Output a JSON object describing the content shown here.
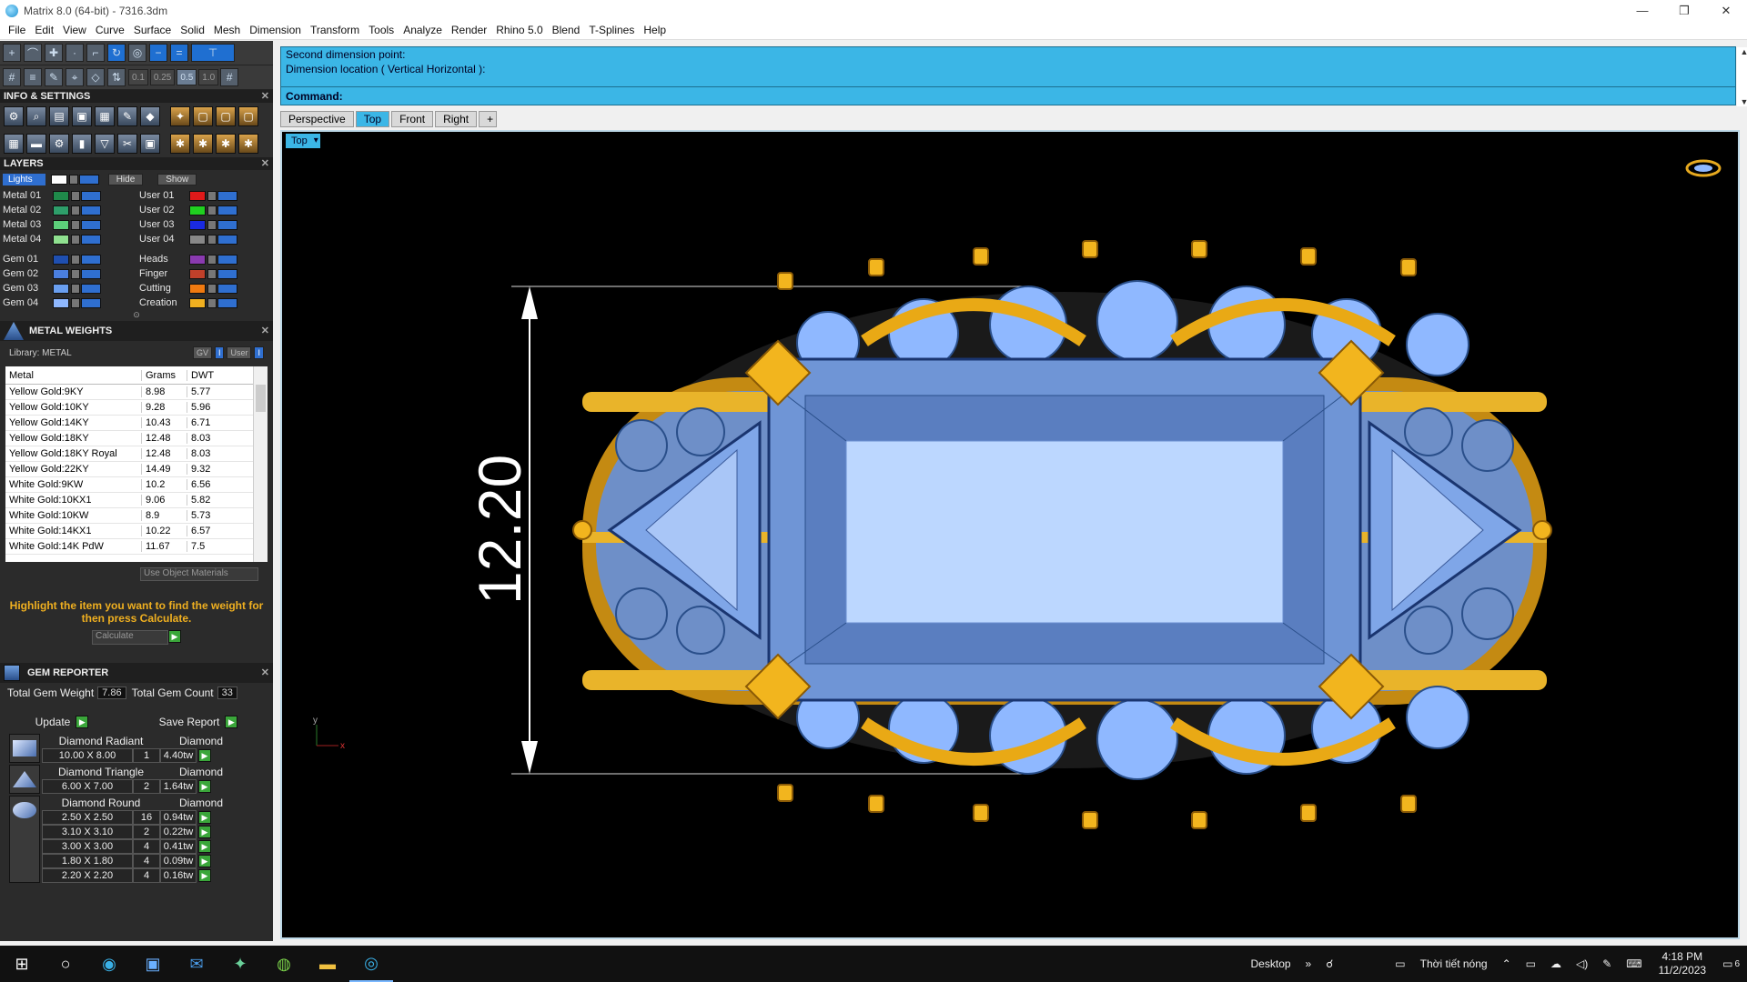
{
  "window": {
    "title": "Matrix 8.0 (64-bit) - 7316.3dm",
    "controls": [
      "—",
      "❐",
      "✕"
    ]
  },
  "menu": [
    "File",
    "Edit",
    "View",
    "Curve",
    "Surface",
    "Solid",
    "Mesh",
    "Dimension",
    "Transform",
    "Tools",
    "Analyze",
    "Render",
    "Rhino 5.0",
    "Blend",
    "T-Splines",
    "Help"
  ],
  "toolbar": {
    "snap_values": [
      "0.1",
      "0.25",
      "0.5",
      "1.0"
    ]
  },
  "info_settings": {
    "title": "INFO & SETTINGS"
  },
  "layers": {
    "title": "LAYERS",
    "lights_label": "Lights",
    "hide_label": "Hide",
    "show_label": "Show",
    "left": [
      {
        "name": "Metal 01",
        "color": "#1f8a4a"
      },
      {
        "name": "Metal 02",
        "color": "#2e9e6a"
      },
      {
        "name": "Metal 03",
        "color": "#5cd07a"
      },
      {
        "name": "Metal 04",
        "color": "#8fe08f"
      },
      {
        "name": "Gem 01",
        "color": "#1f4fb0"
      },
      {
        "name": "Gem 02",
        "color": "#4a7fe0"
      },
      {
        "name": "Gem 03",
        "color": "#6a9ff0"
      },
      {
        "name": "Gem 04",
        "color": "#8fb8ff"
      }
    ],
    "right": [
      {
        "name": "User 01",
        "color": "#e01a1a"
      },
      {
        "name": "User 02",
        "color": "#20d020"
      },
      {
        "name": "User 03",
        "color": "#1a2ae0"
      },
      {
        "name": "User 04",
        "color": "#888888"
      },
      {
        "name": "Heads",
        "color": "#8a3ab0"
      },
      {
        "name": "Finger",
        "color": "#c0402a"
      },
      {
        "name": "Cutting",
        "color": "#f07a10"
      },
      {
        "name": "Creation",
        "color": "#f0b020"
      }
    ]
  },
  "metal_weights": {
    "title": "METAL WEIGHTS",
    "library_label": "Library: METAL",
    "gv_label": "GV",
    "user_label": "User",
    "columns": [
      "Metal",
      "Grams",
      "DWT"
    ],
    "rows": [
      [
        "Yellow Gold:9KY",
        "8.98",
        "5.77"
      ],
      [
        "Yellow Gold:10KY",
        "9.28",
        "5.96"
      ],
      [
        "Yellow Gold:14KY",
        "10.43",
        "6.71"
      ],
      [
        "Yellow Gold:18KY",
        "12.48",
        "8.03"
      ],
      [
        "Yellow Gold:18KY Royal",
        "12.48",
        "8.03"
      ],
      [
        "Yellow Gold:22KY",
        "14.49",
        "9.32"
      ],
      [
        "White Gold:9KW",
        "10.2",
        "6.56"
      ],
      [
        "White Gold:10KX1",
        "9.06",
        "5.82"
      ],
      [
        "White Gold:10KW",
        "8.9",
        "5.73"
      ],
      [
        "White Gold:14KX1",
        "10.22",
        "6.57"
      ],
      [
        "White Gold:14K PdW",
        "11.67",
        "7.5"
      ]
    ],
    "use_object_materials": "Use Object Materials",
    "hint": "Highlight the item you want to find the weight for then press Calculate.",
    "calculate_label": "Calculate"
  },
  "gem_reporter": {
    "title": "GEM REPORTER",
    "total_weight_label": "Total Gem Weight",
    "total_weight": "7.86",
    "total_count_label": "Total Gem Count",
    "total_count": "33",
    "update_label": "Update",
    "save_label": "Save Report",
    "groups": [
      {
        "name": "Diamond Radiant",
        "type": "Diamond",
        "rows": [
          [
            "10.00 X 8.00",
            "1",
            "4.40tw"
          ]
        ]
      },
      {
        "name": "Diamond Triangle",
        "type": "Diamond",
        "rows": [
          [
            "6.00 X 7.00",
            "2",
            "1.64tw"
          ]
        ]
      },
      {
        "name": "Diamond Round",
        "type": "Diamond",
        "rows": [
          [
            "2.50 X 2.50",
            "16",
            "0.94tw"
          ],
          [
            "3.10 X 3.10",
            "2",
            "0.22tw"
          ],
          [
            "3.00 X 3.00",
            "4",
            "0.41tw"
          ],
          [
            "1.80 X 1.80",
            "4",
            "0.09tw"
          ],
          [
            "2.20 X 2.20",
            "4",
            "0.16tw"
          ]
        ]
      }
    ]
  },
  "command": {
    "line1": "Second dimension point:",
    "line2": "Dimension location ( Vertical  Horizontal ):",
    "prompt": "Command:"
  },
  "viewport_tabs": [
    "Perspective",
    "Top",
    "Front",
    "Right"
  ],
  "viewport": {
    "label": "Top",
    "dimension_value": "12.20",
    "axis_y": "y",
    "axis_x": "x"
  },
  "taskbar": {
    "desktop_label": "Desktop",
    "weather": "Thời tiết nóng",
    "time": "4:18 PM",
    "date": "11/2/2023",
    "notification_count": "6"
  }
}
